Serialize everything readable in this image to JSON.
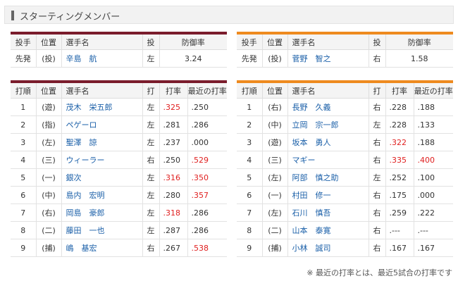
{
  "header": {
    "title": "スターティングメンバー"
  },
  "pitcher_headers": [
    "投手",
    "位置",
    "選手名",
    "投",
    "防御率"
  ],
  "lineup_headers": [
    "打順",
    "位置",
    "選手名",
    "打",
    "打率",
    "最近の打率"
  ],
  "left": {
    "pitcher": {
      "role": "先発",
      "pos": "(投)",
      "name": "辛島　航",
      "hand": "左",
      "era": "3.24"
    },
    "lineup": [
      {
        "order": "1",
        "pos": "(遊)",
        "name": "茂木　栄五郎",
        "hand": "左",
        "avg": ".325",
        "recent": ".250",
        "avg_red": true,
        "recent_red": false
      },
      {
        "order": "2",
        "pos": "(指)",
        "name": "ペゲーロ",
        "hand": "左",
        "avg": ".281",
        "recent": ".286",
        "avg_red": false,
        "recent_red": false
      },
      {
        "order": "3",
        "pos": "(左)",
        "name": "聖澤　諒",
        "hand": "左",
        "avg": ".237",
        "recent": ".000",
        "avg_red": false,
        "recent_red": false
      },
      {
        "order": "4",
        "pos": "(三)",
        "name": "ウィーラー",
        "hand": "右",
        "avg": ".250",
        "recent": ".529",
        "avg_red": false,
        "recent_red": true
      },
      {
        "order": "5",
        "pos": "(一)",
        "name": "銀次",
        "hand": "左",
        "avg": ".316",
        "recent": ".350",
        "avg_red": true,
        "recent_red": true
      },
      {
        "order": "6",
        "pos": "(中)",
        "name": "島内　宏明",
        "hand": "左",
        "avg": ".280",
        "recent": ".357",
        "avg_red": false,
        "recent_red": true
      },
      {
        "order": "7",
        "pos": "(右)",
        "name": "岡島　豪郎",
        "hand": "左",
        "avg": ".318",
        "recent": ".286",
        "avg_red": true,
        "recent_red": false
      },
      {
        "order": "8",
        "pos": "(二)",
        "name": "藤田　一也",
        "hand": "左",
        "avg": ".287",
        "recent": ".286",
        "avg_red": false,
        "recent_red": false
      },
      {
        "order": "9",
        "pos": "(捕)",
        "name": "嶋　基宏",
        "hand": "右",
        "avg": ".267",
        "recent": ".538",
        "avg_red": false,
        "recent_red": true
      }
    ]
  },
  "right": {
    "pitcher": {
      "role": "先発",
      "pos": "(投)",
      "name": "菅野　智之",
      "hand": "右",
      "era": "1.58"
    },
    "lineup": [
      {
        "order": "1",
        "pos": "(右)",
        "name": "長野　久義",
        "hand": "右",
        "avg": ".228",
        "recent": ".188",
        "avg_red": false,
        "recent_red": false
      },
      {
        "order": "2",
        "pos": "(中)",
        "name": "立岡　宗一郎",
        "hand": "左",
        "avg": ".228",
        "recent": ".133",
        "avg_red": false,
        "recent_red": false
      },
      {
        "order": "3",
        "pos": "(遊)",
        "name": "坂本　勇人",
        "hand": "右",
        "avg": ".322",
        "recent": ".188",
        "avg_red": true,
        "recent_red": false
      },
      {
        "order": "4",
        "pos": "(三)",
        "name": "マギー",
        "hand": "右",
        "avg": ".335",
        "recent": ".400",
        "avg_red": true,
        "recent_red": true
      },
      {
        "order": "5",
        "pos": "(左)",
        "name": "阿部　慎之助",
        "hand": "左",
        "avg": ".252",
        "recent": ".100",
        "avg_red": false,
        "recent_red": false
      },
      {
        "order": "6",
        "pos": "(一)",
        "name": "村田　修一",
        "hand": "右",
        "avg": ".175",
        "recent": ".000",
        "avg_red": false,
        "recent_red": false
      },
      {
        "order": "7",
        "pos": "(左)",
        "name": "石川　慎吾",
        "hand": "右",
        "avg": ".259",
        "recent": ".222",
        "avg_red": false,
        "recent_red": false
      },
      {
        "order": "8",
        "pos": "(二)",
        "name": "山本　泰寛",
        "hand": "右",
        "avg": ".---",
        "recent": ".---",
        "avg_red": false,
        "recent_red": false
      },
      {
        "order": "9",
        "pos": "(捕)",
        "name": "小林　誠司",
        "hand": "右",
        "avg": ".167",
        "recent": ".167",
        "avg_red": false,
        "recent_red": false
      }
    ]
  },
  "footnote": "※ 最近の打率とは、最近5試合の打率です",
  "colors": {
    "left_accent": "#7a1c2c",
    "right_accent": "#ee8a1f",
    "highlight": "#e02020",
    "link": "#1a5fa8"
  }
}
